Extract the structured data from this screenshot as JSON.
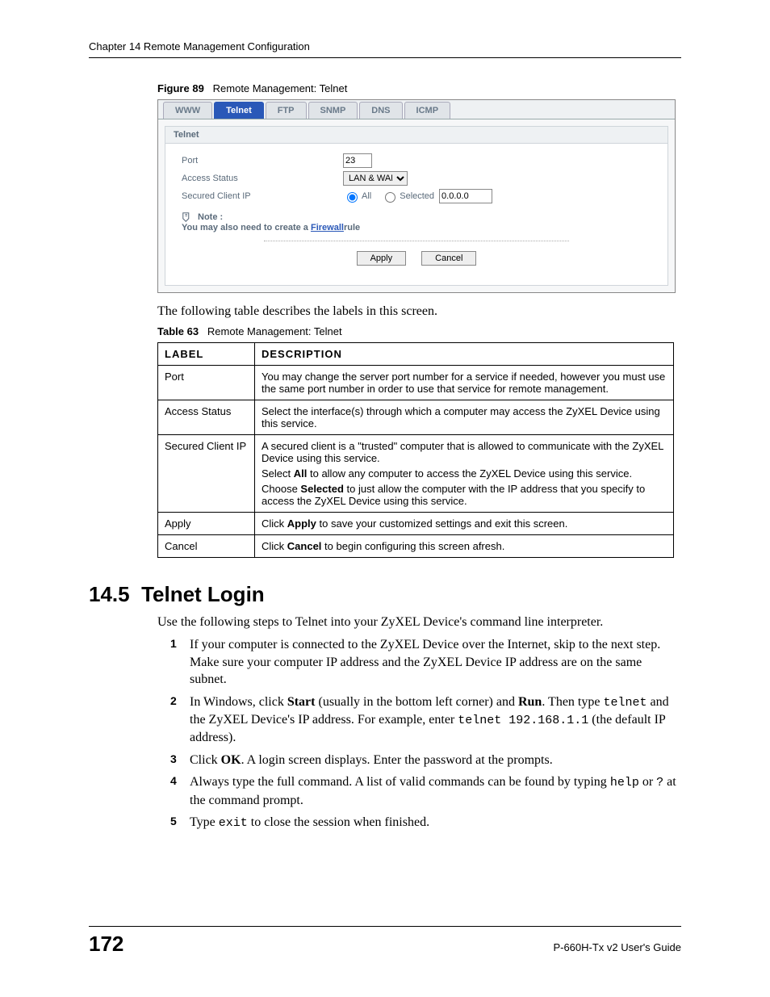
{
  "header": {
    "chapter": "Chapter 14 Remote Management Configuration"
  },
  "figure": {
    "label": "Figure 89",
    "caption": "Remote Management: Telnet",
    "tabs": [
      "WWW",
      "Telnet",
      "FTP",
      "SNMP",
      "DNS",
      "ICMP"
    ],
    "active_tab": "Telnet",
    "panel_title": "Telnet",
    "form": {
      "port_label": "Port",
      "port_value": "23",
      "access_label": "Access Status",
      "access_value": "LAN & WAN",
      "secured_label": "Secured Client IP",
      "radio_all": "All",
      "radio_selected": "Selected",
      "selected_ip": "0.0.0.0"
    },
    "note_label": "Note :",
    "note_text_prefix": "You may also need to create a ",
    "note_link": "Firewall",
    "note_text_suffix": "rule",
    "apply": "Apply",
    "cancel": "Cancel"
  },
  "para1": "The following table describes the labels in this screen.",
  "table": {
    "label": "Table 63",
    "caption": "Remote Management: Telnet",
    "head_label": "LABEL",
    "head_desc": "DESCRIPTION",
    "rows": [
      {
        "label": "Port",
        "desc": "You may change the server port number for a service if needed, however you must use the same port number in order to use that service for remote management."
      },
      {
        "label": "Access Status",
        "desc": "Select the interface(s) through which a computer may access the ZyXEL Device using this service."
      },
      {
        "label": "Secured Client IP",
        "desc_p1": "A secured client is a \"trusted\" computer that is allowed to communicate with the ZyXEL Device using this service.",
        "desc_p2_pre": "Select ",
        "desc_p2_b1": "All",
        "desc_p2_mid": " to allow any computer to access the ZyXEL Device using this service.",
        "desc_p3_pre": "Choose ",
        "desc_p3_b1": "Selected",
        "desc_p3_post": " to just allow the computer with the IP address that you specify to access the ZyXEL Device using this service."
      },
      {
        "label": "Apply",
        "desc_pre": "Click ",
        "desc_b": "Apply",
        "desc_post": " to save your customized settings and exit this screen."
      },
      {
        "label": "Cancel",
        "desc_pre": "Click ",
        "desc_b": "Cancel",
        "desc_post": " to begin configuring this screen afresh."
      }
    ]
  },
  "section": {
    "number": "14.5",
    "title": "Telnet Login",
    "intro": "Use the following steps to Telnet into your ZyXEL Device's command line interpreter.",
    "steps": {
      "s1": "If your computer is connected to the ZyXEL Device over the Internet, skip to the next step. Make sure your computer IP address and the ZyXEL Device IP address are on the same subnet.",
      "s2_a": "In Windows, click ",
      "s2_b1": "Start",
      "s2_b": " (usually in the bottom left corner) and ",
      "s2_b2": "Run",
      "s2_c": ". Then type ",
      "s2_code1": "telnet",
      "s2_d": " and the ZyXEL Device's IP address. For example, enter ",
      "s2_code2": "telnet 192.168.1.1",
      "s2_e": " (the default IP address).",
      "s3_a": "Click ",
      "s3_b": "OK",
      "s3_c": ". A login screen displays. Enter the password at the prompts.",
      "s4_a": "Always type the full command. A list of valid commands can be found by typing ",
      "s4_code1": "help",
      "s4_b": " or ",
      "s4_code2": "?",
      "s4_c": " at the command prompt.",
      "s5_a": "Type ",
      "s5_code": "exit",
      "s5_b": " to close the session when finished."
    }
  },
  "footer": {
    "page": "172",
    "guide": "P-660H-Tx v2 User's Guide"
  }
}
